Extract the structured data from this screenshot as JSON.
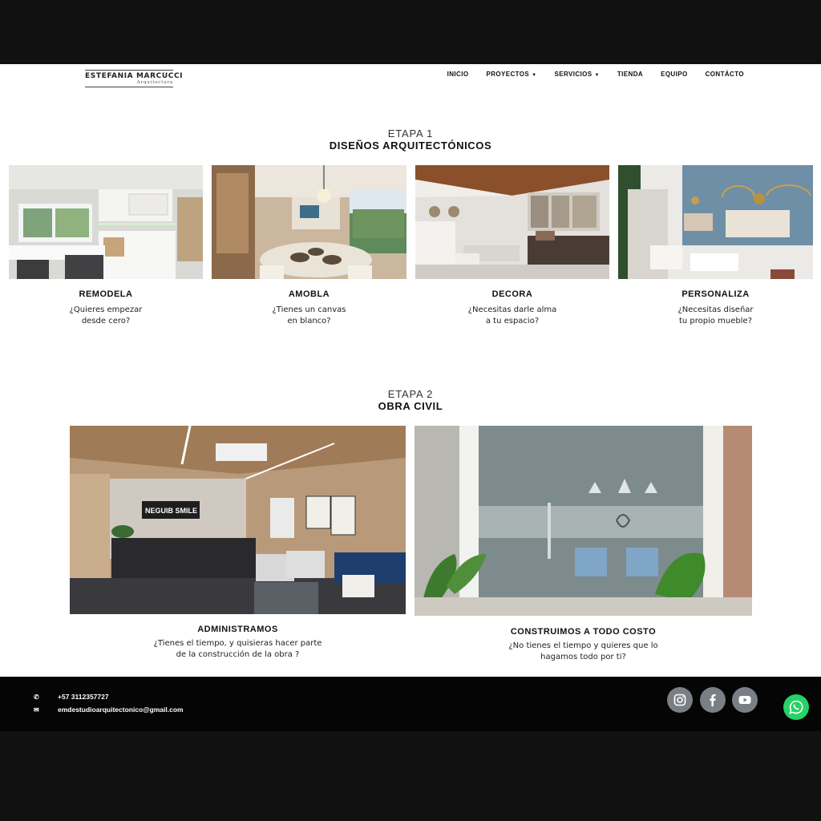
{
  "header": {
    "logo": {
      "brand": "ESTEFANIA MARCUCCI",
      "sub": "Arquitectura"
    },
    "nav": [
      {
        "label": "INICIO",
        "dropdown": false
      },
      {
        "label": "PROYECTOS",
        "dropdown": true
      },
      {
        "label": "SERVICIOS",
        "dropdown": true
      },
      {
        "label": "TIENDA",
        "dropdown": false
      },
      {
        "label": "EQUIPO",
        "dropdown": false
      },
      {
        "label": "CONTÁCTO",
        "dropdown": false
      }
    ]
  },
  "stage1": {
    "label": "ETAPA 1",
    "title": "DISEÑOS ARQUITECTÓNICOS",
    "cards": [
      {
        "title": "REMODELA",
        "desc": "¿Quieres empezar\ndesde cero?"
      },
      {
        "title": "AMOBLA",
        "desc": "¿Tienes un canvas\nen blanco?"
      },
      {
        "title": "DECORA",
        "desc": "¿Necesitas darle alma\na tu espacio?"
      },
      {
        "title": "PERSONALIZA",
        "desc": "¿Necesitas diseñar\ntu propio mueble?"
      }
    ]
  },
  "stage2": {
    "label": "ETAPA 2",
    "title": "OBRA CIVIL",
    "cards": [
      {
        "title": "ADMINISTRAMOS",
        "desc": "¿Tienes el tiempo, y quisieras hacer parte\nde la construcción de la obra ?",
        "sign_text": "NEGUIB SMILE"
      },
      {
        "title": "CONSTRUIMOS A TODO COSTO",
        "desc": "¿No tienes el tiempo y quieres que lo\nhagamos todo por ti?"
      }
    ]
  },
  "footer": {
    "phone": "+57 3112357727",
    "email": "emdestudioarquitectonico@gmail.com",
    "social": [
      "instagram-icon",
      "facebook-icon",
      "youtube-icon"
    ],
    "whatsapp": "whatsapp-icon"
  },
  "colors": {
    "page": "#ffffff",
    "frame": "#111111",
    "footer": "#050505",
    "social": "#7a7f85",
    "whatsapp": "#25d366",
    "accent_wall": "#6f8fa6"
  }
}
